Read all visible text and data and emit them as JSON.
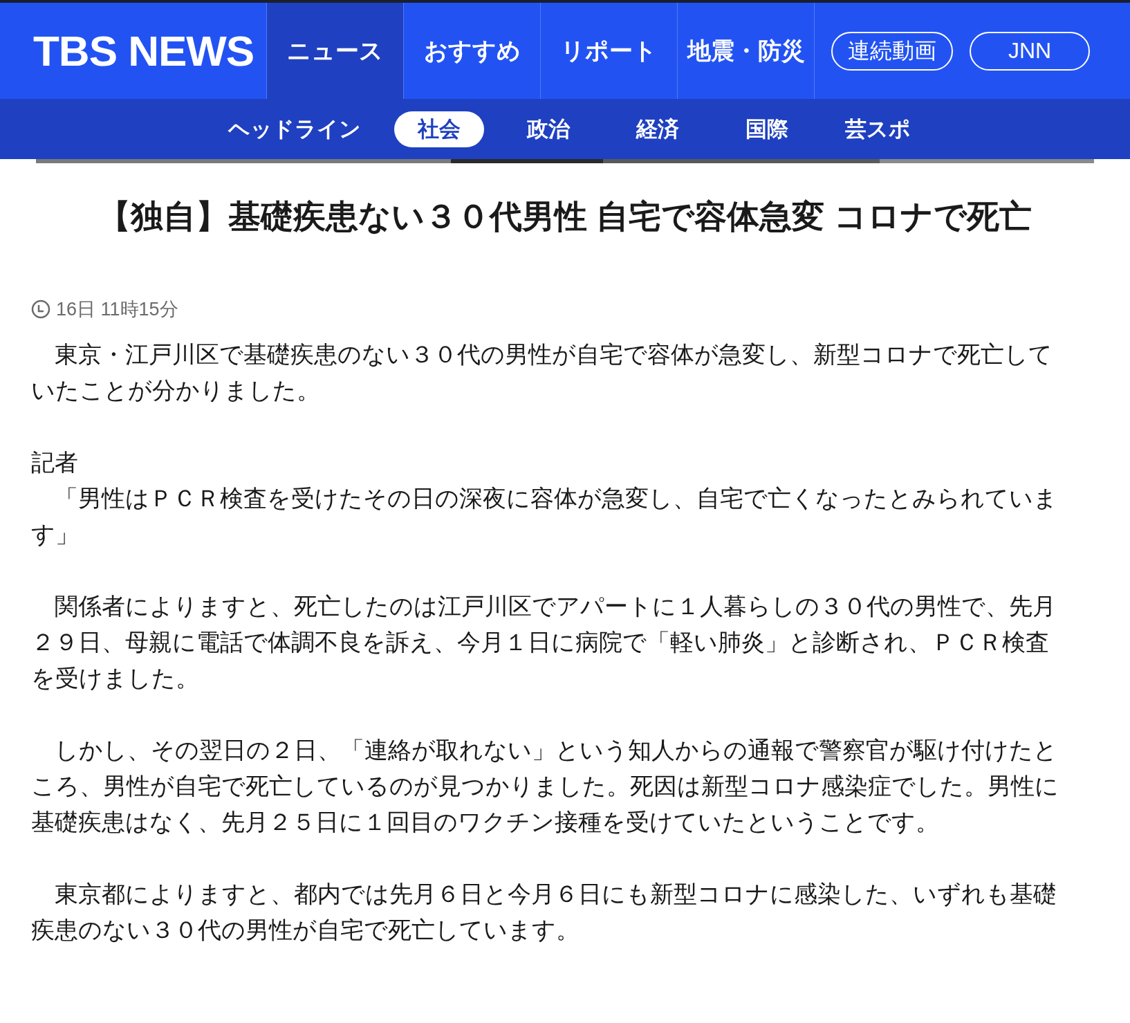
{
  "header": {
    "logo": "TBS NEWS",
    "nav": [
      {
        "label": "ニュース",
        "selected": true,
        "kind": "tab"
      },
      {
        "label": "おすすめ",
        "selected": false,
        "kind": "tab"
      },
      {
        "label": "リポート",
        "selected": false,
        "kind": "tab"
      },
      {
        "label": "地震・防災",
        "selected": false,
        "kind": "tab"
      },
      {
        "label": "連続動画",
        "selected": false,
        "kind": "pill"
      },
      {
        "label": "JNN",
        "selected": false,
        "kind": "pill"
      }
    ]
  },
  "subnav": [
    {
      "label": "ヘッドライン",
      "selected": false
    },
    {
      "label": "社会",
      "selected": true
    },
    {
      "label": "政治",
      "selected": false
    },
    {
      "label": "経済",
      "selected": false
    },
    {
      "label": "国際",
      "selected": false
    },
    {
      "label": "芸スポ",
      "selected": false
    }
  ],
  "article": {
    "title": "【独自】基礎疾患ない３０代男性 自宅で容体急変 コロナで死亡",
    "timestamp": "16日 11時15分",
    "body": [
      {
        "kind": "paragraph",
        "text": "東京・江戸川区で基礎疾患のない３０代の男性が自宅で容体が急変し、新型コロナで死亡していたことが分かりました。"
      },
      {
        "kind": "speaker",
        "text": "記者"
      },
      {
        "kind": "quote",
        "text": "「男性はＰＣＲ検査を受けたその日の深夜に容体が急変し、自宅で亡くなったとみられています」"
      },
      {
        "kind": "paragraph",
        "text": "関係者によりますと、死亡したのは江戸川区でアパートに１人暮らしの３０代の男性で、先月２９日、母親に電話で体調不良を訴え、今月１日に病院で「軽い肺炎」と診断され、ＰＣＲ検査を受けました。"
      },
      {
        "kind": "paragraph",
        "text": "しかし、その翌日の２日、「連絡が取れない」という知人からの通報で警察官が駆け付けたところ、男性が自宅で死亡しているのが見つかりました。死因は新型コロナ感染症でした。男性に基礎疾患はなく、先月２５日に１回目のワクチン接種を受けていたということです。"
      },
      {
        "kind": "paragraph",
        "text": "東京都によりますと、都内では先月６日と今月６日にも新型コロナに感染した、いずれも基礎疾患のない３０代の男性が自宅で死亡しています。"
      }
    ]
  }
}
